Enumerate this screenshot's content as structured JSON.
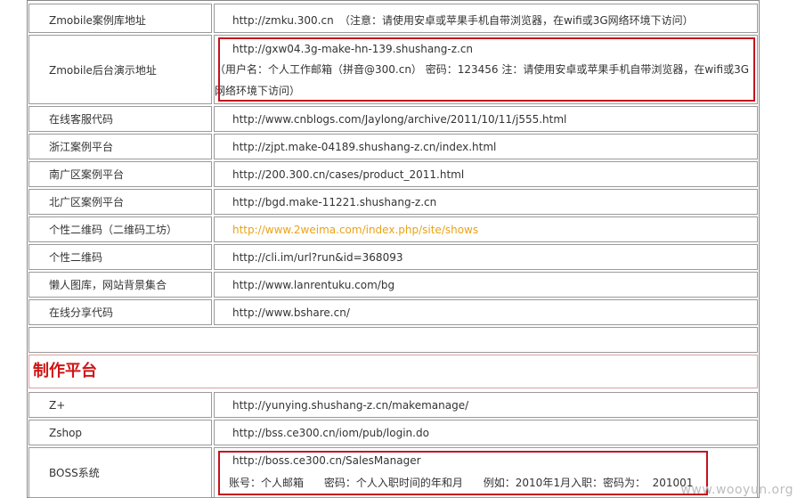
{
  "rows": [
    {
      "label": "Zmobile案例库地址",
      "url": "http://zmku.300.cn",
      "note": "（注意：请使用安卓或苹果手机自带浏览器，在wifi或3G网络环境下访问）"
    },
    {
      "label": "Zmobile后台演示地址",
      "url": "http://gxw04.3g-make-hn-139.shushang-z.cn",
      "note": "（用户名：个人工作邮箱（拼音@300.cn） 密码：123456 注：请使用安卓或苹果手机自带浏览器，在wifi或3G网络环境下访问）"
    },
    {
      "label": "在线客服代码",
      "url": "http://www.cnblogs.com/Jaylong/archive/2011/10/11/j555.html"
    },
    {
      "label": "浙江案例平台",
      "url": "http://zjpt.make-04189.shushang-z.cn/index.html"
    },
    {
      "label": "南广区案例平台",
      "url": "http://200.300.cn/cases/product_2011.html"
    },
    {
      "label": "北广区案例平台",
      "url": "http://bgd.make-11221.shushang-z.cn"
    },
    {
      "label": "个性二维码（二维码工坊）",
      "url": "http://www.2weima.com/index.php/site/shows"
    },
    {
      "label": "个性二维码",
      "url": "http://cli.im/url?run&id=368093"
    },
    {
      "label": "懒人图库，网站背景集合",
      "url": "http://www.lanrentuku.com/bg"
    },
    {
      "label": "在线分享代码",
      "url": "http://www.bshare.cn/"
    }
  ],
  "section_title": "制作平台",
  "platform_rows": [
    {
      "label": "Z+",
      "url": "http://yunying.shushang-z.cn/makemanage/"
    },
    {
      "label": "Zshop",
      "url": "http://bss.ce300.cn/iom/pub/login.do"
    },
    {
      "label": "BOSS系统",
      "url": "http://boss.ce300.cn/SalesManager",
      "note": "账号：个人邮箱      密码：个人入职时间的年和月      例如：2010年1月入职：密码为：  201001"
    }
  ],
  "watermark": "www.wooyun.org",
  "colors": {
    "highlight_box": "#c4121f",
    "section_title": "#d01515",
    "orange_link": "#e8a317"
  }
}
